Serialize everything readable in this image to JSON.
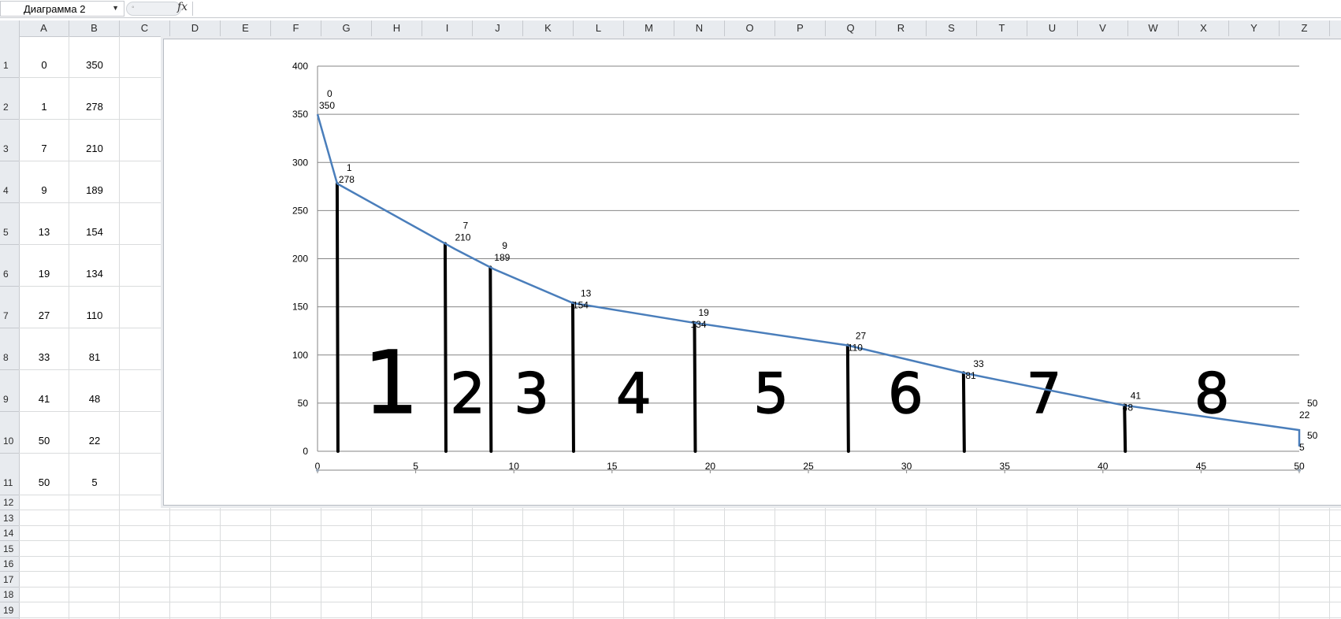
{
  "formula_bar": {
    "name_box": "Диаграмма 2",
    "fx_label": "fx"
  },
  "grid": {
    "columns": [
      "A",
      "B",
      "C",
      "D",
      "E",
      "F",
      "G",
      "H",
      "I",
      "J",
      "K",
      "L",
      "M",
      "N",
      "O",
      "P",
      "Q",
      "R",
      "S",
      "T",
      "U",
      "V",
      "W",
      "X",
      "Y",
      "Z"
    ],
    "rows": [
      "1",
      "2",
      "3",
      "4",
      "5",
      "6",
      "7",
      "8",
      "9",
      "10",
      "11",
      "12",
      "13",
      "14",
      "15",
      "16",
      "17",
      "18",
      "19"
    ],
    "cells_A": [
      "0",
      "1",
      "7",
      "9",
      "13",
      "19",
      "27",
      "33",
      "41",
      "50",
      "50"
    ],
    "cells_B": [
      "350",
      "278",
      "210",
      "189",
      "154",
      "134",
      "110",
      "81",
      "48",
      "22",
      "5"
    ]
  },
  "chart_data": {
    "type": "scatter",
    "series": [
      {
        "x": [
          0,
          1,
          7,
          9,
          13,
          19,
          27,
          33,
          41,
          50,
          50
        ],
        "y": [
          350,
          278,
          210,
          189,
          154,
          134,
          110,
          81,
          48,
          22,
          5
        ],
        "labels": [
          [
            "0",
            "350"
          ],
          [
            "1",
            "278"
          ],
          [
            "7",
            "210"
          ],
          [
            "9",
            "189"
          ],
          [
            "13",
            "154"
          ],
          [
            "19",
            "134"
          ],
          [
            "27",
            "110"
          ],
          [
            "33",
            "81"
          ],
          [
            "41",
            "48"
          ],
          [
            "50",
            "22"
          ],
          [
            "50",
            "5"
          ]
        ]
      }
    ],
    "xlim": [
      0,
      50
    ],
    "ylim": [
      0,
      400
    ],
    "x_ticks": [
      "0",
      "5",
      "10",
      "15",
      "20",
      "25",
      "30",
      "35",
      "40",
      "45",
      "50"
    ],
    "y_ticks": [
      "0",
      "50",
      "100",
      "150",
      "200",
      "250",
      "300",
      "350",
      "400"
    ],
    "grid": true,
    "line_color": "#4a7ebb",
    "annotation_x": [
      1,
      6.5,
      8.8,
      13,
      19.2,
      27,
      32.9,
      41.1
    ],
    "annotation_numbers": [
      "1",
      "2",
      "3",
      "4",
      "5",
      "6",
      "7",
      "8"
    ]
  }
}
